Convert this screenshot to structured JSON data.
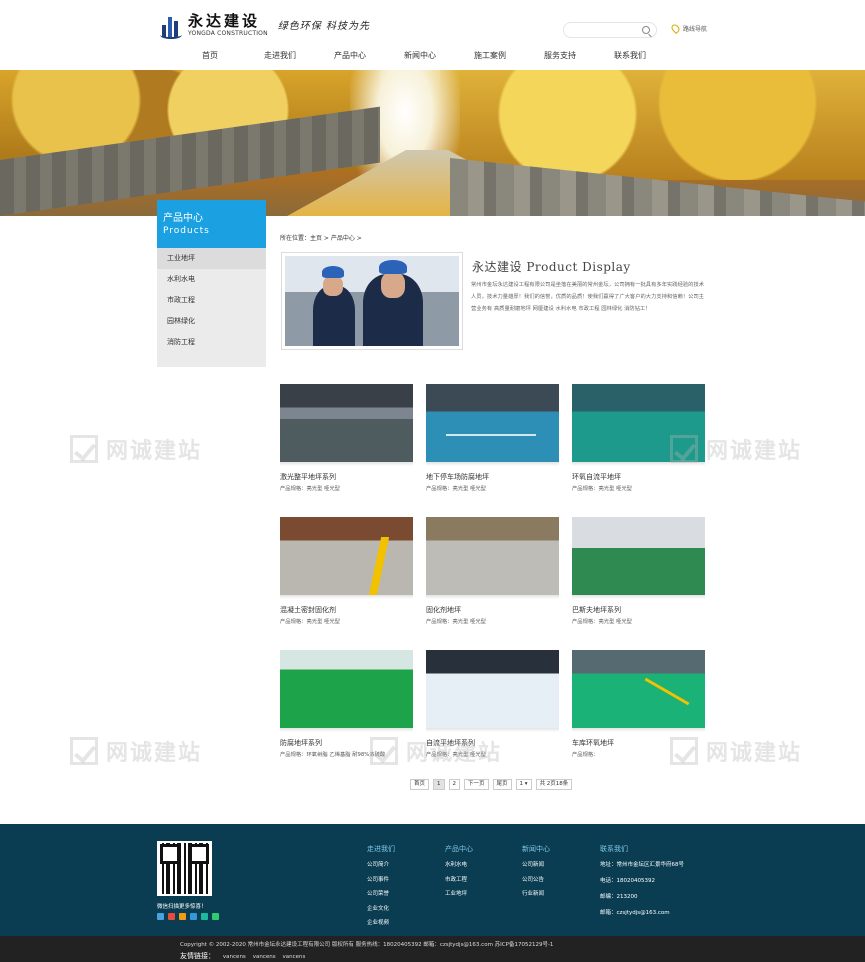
{
  "header": {
    "brand_cn": "永达建设",
    "brand_en": "YONGDA CONSTRUCTION",
    "slogan": "绿色环保  科技为先",
    "map_link": "路线导航"
  },
  "nav": [
    "首页",
    "走进我们",
    "产品中心",
    "新闻中心",
    "施工案例",
    "服务支持",
    "联系我们"
  ],
  "sidebar": {
    "title_cn": "产品中心",
    "title_en": "Products",
    "items": [
      {
        "label": "工业地坪",
        "active": true
      },
      {
        "label": "水利水电"
      },
      {
        "label": "市政工程"
      },
      {
        "label": "园林绿化"
      },
      {
        "label": "消防工程"
      }
    ]
  },
  "breadcrumb": "所在位置：主页 > 产品中心 >",
  "intro": {
    "title": "永达建设 Product Display",
    "text": "常州市金坛永达建设工程有限公司是坐落在美丽的常州金坛，公司拥有一批具有多年实践经验的技术人员，技术力量雄厚！我们的信誉，优质的品质！使我们赢得了广大客户的大力支持和信赖！公司主营业务有 高质量耐磨地坪 网厘建设 水利水电 市政工程 园林绿化 消防钻工！"
  },
  "products": [
    {
      "name": "激光整平地坪系列",
      "spec": "产品规格：亮光型 哑光型"
    },
    {
      "name": "地下停车场防腐地坪",
      "spec": "产品规格：亮光型 哑光型"
    },
    {
      "name": "环氧自流平地坪",
      "spec": "产品规格：亮光型 哑光型"
    },
    {
      "name": "混凝土密封固化剂",
      "spec": "产品规格：亮光型 哑光型"
    },
    {
      "name": "固化剂地坪",
      "spec": "产品规格：亮光型 哑光型"
    },
    {
      "name": "巴斯夫地坪系列",
      "spec": "产品规格：亮光型 哑光型"
    },
    {
      "name": "防腐地坪系列",
      "spec": "产品规格：环氧树脂 乙烯基脂 耐98%浓硫酸"
    },
    {
      "name": "自流平地坪系列",
      "spec": "产品规格：亮光型 哑光型"
    },
    {
      "name": "车库环氧地坪",
      "spec": "产品规格："
    }
  ],
  "pagination": {
    "first": "首页",
    "pages": [
      "1",
      "2"
    ],
    "current": "1",
    "next": "下一页",
    "last": "尾页",
    "select": "1 ▾",
    "summary": "共 2页18条"
  },
  "watermark": "网诚建站",
  "footer": {
    "qr_caption": "微信扫描更多惊喜！",
    "social_colors": [
      "#4aa3df",
      "#e74c3c",
      "#f39c12",
      "#3498db",
      "#1abc9c",
      "#2ecc71"
    ],
    "columns": [
      {
        "head": "走进我们",
        "links": [
          "公司简介",
          "公司事件",
          "公司荣誉",
          "企业文化",
          "企业视频"
        ]
      },
      {
        "head": "产品中心",
        "links": [
          "水利水电",
          "市政工程",
          "工业地坪"
        ]
      },
      {
        "head": "新闻中心",
        "links": [
          "公司新闻",
          "公司公告",
          "行业新闻"
        ]
      },
      {
        "head": "联系我们",
        "links": [
          "地址：常州市金坛区汇景华府68号",
          "电话：18020405392",
          "邮编：213200",
          "邮箱：czsjtydjs@163.com"
        ]
      }
    ]
  },
  "copyright": {
    "line1": "Copyright © 2002-2020  常州市金坛永达建设工程有限公司 版权所有     服务热线：18020405392     邮箱：czsjtydjs@163.com     苏ICP备17052129号-1",
    "friend_label": "友情链接：",
    "friend_links": [
      "vancens",
      "vancens",
      "vancens"
    ]
  },
  "colors": {
    "accent": "#1ba1e2",
    "footer_bg": "#0a3d52",
    "copyright_bg": "#222222"
  }
}
